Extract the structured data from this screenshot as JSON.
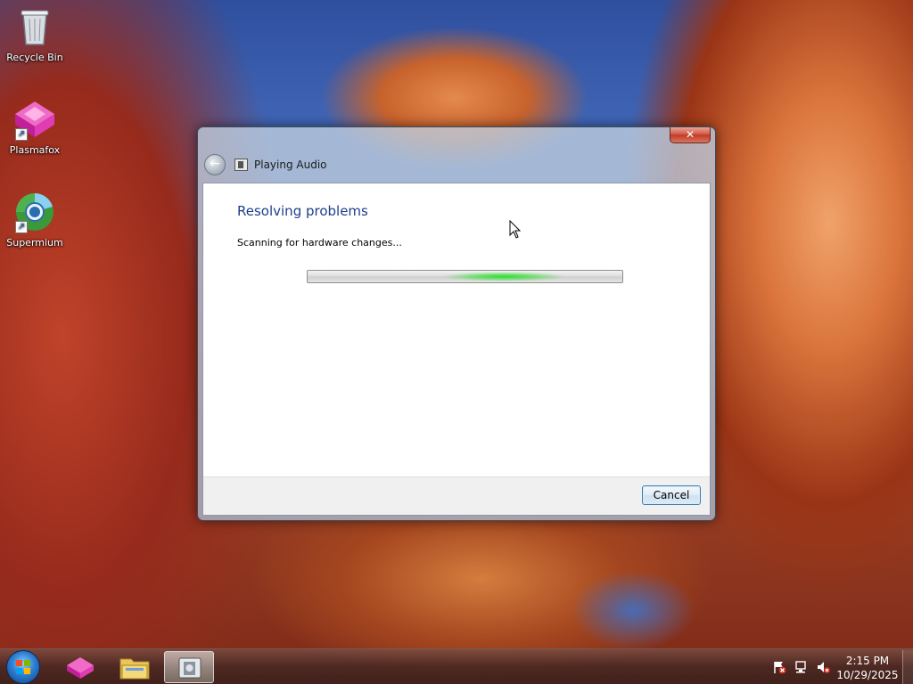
{
  "desktop": {
    "icons": [
      {
        "label": "Recycle Bin"
      },
      {
        "label": "Plasmafox"
      },
      {
        "label": "Supermium"
      }
    ]
  },
  "window": {
    "title": "Playing Audio",
    "close_label": "✕",
    "heading": "Resolving problems",
    "status": "Scanning for hardware changes...",
    "cancel_label": "Cancel"
  },
  "taskbar": {
    "time": "2:15 PM",
    "date": "10/29/2025"
  },
  "colors": {
    "heading": "#1e3f8a",
    "progress_glow": "#2ee02e"
  },
  "icons": [
    "recycle-bin-icon",
    "plasmafox-icon",
    "supermium-icon",
    "back-arrow-icon",
    "close-icon",
    "troubleshooter-icon",
    "windows-start-icon",
    "folder-icon",
    "action-center-flag-icon",
    "network-icon",
    "volume-muted-icon"
  ]
}
